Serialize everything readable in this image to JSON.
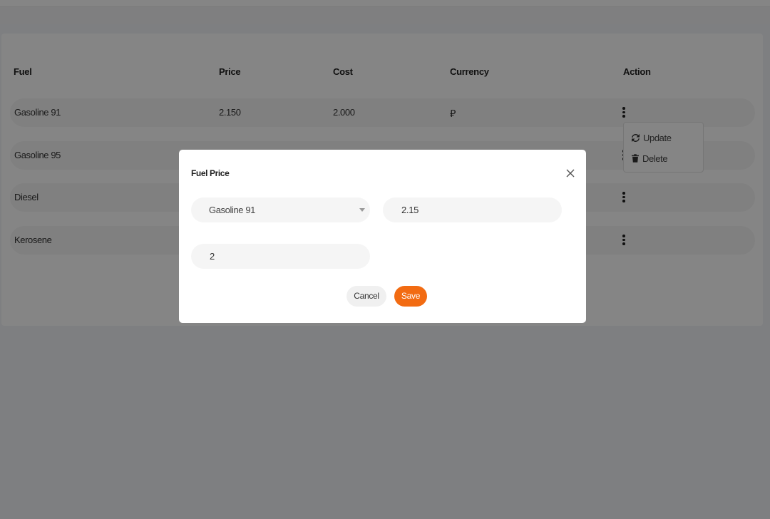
{
  "table": {
    "headers": {
      "fuel": "Fuel",
      "price": "Price",
      "cost": "Cost",
      "currency": "Currency",
      "action": "Action"
    },
    "rows": [
      {
        "fuel": "Gasoline 91",
        "price": "2.150",
        "cost": "2.000",
        "currency": "⃁"
      },
      {
        "fuel": "Gasoline 95",
        "price": "",
        "cost": "",
        "currency": ""
      },
      {
        "fuel": "Diesel",
        "price": "",
        "cost": "",
        "currency": ""
      },
      {
        "fuel": "Kerosene",
        "price": "",
        "cost": "",
        "currency": ""
      }
    ]
  },
  "action_menu": {
    "update_label": "Update",
    "delete_label": "Delete"
  },
  "modal": {
    "title": "Fuel Price",
    "fuel_select_value": "Gasoline 91",
    "price_value": "2.15",
    "cost_value": "2",
    "cancel_label": "Cancel",
    "save_label": "Save"
  },
  "colors": {
    "accent": "#f26b12",
    "overlay": "rgba(0,0,0,0.48)",
    "row_bg": "#f5f5f5"
  },
  "icons": {
    "row_action": "kebab-menu-icon",
    "update": "refresh-icon",
    "delete": "trash-icon",
    "close": "close-icon",
    "select": "chevron-down-icon",
    "currency": "currency-symbol"
  }
}
